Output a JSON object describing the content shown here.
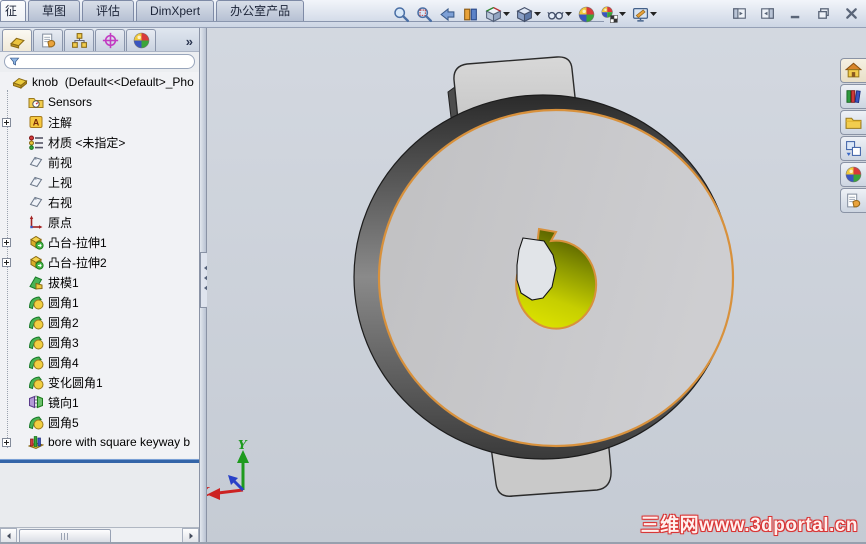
{
  "title_tabs": {
    "items": [
      "征",
      "草图",
      "评估",
      "DimXpert",
      "办公室产品"
    ],
    "active_index": 0
  },
  "headsup_toolbar": {
    "icons": [
      {
        "name": "zoom-to-fit",
        "dropdown": false
      },
      {
        "name": "zoom-to-area",
        "dropdown": false
      },
      {
        "name": "previous-view",
        "dropdown": false
      },
      {
        "name": "section-view",
        "dropdown": false
      },
      {
        "name": "view-orientation",
        "dropdown": true
      },
      {
        "name": "display-style",
        "dropdown": true
      },
      {
        "name": "hide-show-items",
        "dropdown": true
      },
      {
        "name": "edit-appearance",
        "dropdown": false
      },
      {
        "name": "apply-scene",
        "dropdown": true
      },
      {
        "name": "view-settings",
        "dropdown": true
      }
    ]
  },
  "window_controls": [
    "dock-left",
    "dock-right",
    "minimize",
    "restore",
    "close"
  ],
  "left_panel": {
    "tabs": [
      {
        "name": "featuremanager",
        "active": true
      },
      {
        "name": "propertymanager",
        "active": false
      },
      {
        "name": "configurationmanager",
        "active": false
      },
      {
        "name": "dimxpertmanager",
        "active": false
      },
      {
        "name": "displaymanager",
        "active": false
      }
    ],
    "overflow_label": "»",
    "filter_placeholder": "",
    "tree": {
      "root": {
        "label": "knob  (Default<<Default>_Pho",
        "icon": "part-icon"
      },
      "items": [
        {
          "label": "Sensors",
          "icon": "sensors-icon",
          "expandable": false
        },
        {
          "label": "注解",
          "icon": "annotations-icon",
          "expandable": true
        },
        {
          "label": "材质 <未指定>",
          "icon": "material-icon",
          "expandable": false
        },
        {
          "label": "前视",
          "icon": "plane-icon",
          "expandable": false
        },
        {
          "label": "上视",
          "icon": "plane-icon",
          "expandable": false
        },
        {
          "label": "右视",
          "icon": "plane-icon",
          "expandable": false
        },
        {
          "label": "原点",
          "icon": "origin-icon",
          "expandable": false
        },
        {
          "label": "凸台-拉伸1",
          "icon": "boss-extrude-icon",
          "expandable": true
        },
        {
          "label": "凸台-拉伸2",
          "icon": "boss-extrude-icon",
          "expandable": true
        },
        {
          "label": "拔模1",
          "icon": "draft-icon",
          "expandable": false
        },
        {
          "label": "圆角1",
          "icon": "fillet-icon",
          "expandable": false
        },
        {
          "label": "圆角2",
          "icon": "fillet-icon",
          "expandable": false
        },
        {
          "label": "圆角3",
          "icon": "fillet-icon",
          "expandable": false
        },
        {
          "label": "圆角4",
          "icon": "fillet-icon",
          "expandable": false
        },
        {
          "label": "变化圆角1",
          "icon": "fillet-icon",
          "expandable": false
        },
        {
          "label": "镜向1",
          "icon": "mirror-icon",
          "expandable": false
        },
        {
          "label": "圆角5",
          "icon": "fillet-icon",
          "expandable": false
        },
        {
          "label": "bore with square keyway b",
          "icon": "library-feature-icon",
          "expandable": true
        }
      ]
    }
  },
  "right_pane": {
    "tabs": [
      "solidworks-resources",
      "design-library",
      "file-explorer",
      "view-palette",
      "appearances",
      "custom-properties"
    ]
  },
  "viewport": {
    "triad": {
      "x_label": "X",
      "y_label": "Y"
    },
    "watermark": "三维网www.3dportal.cn"
  },
  "colors": {
    "edge_highlight": "#d8913c",
    "bore_yellow": "#d6d800",
    "rollback_bar": "#3465a8",
    "viewport_background": "#cbd1da"
  }
}
